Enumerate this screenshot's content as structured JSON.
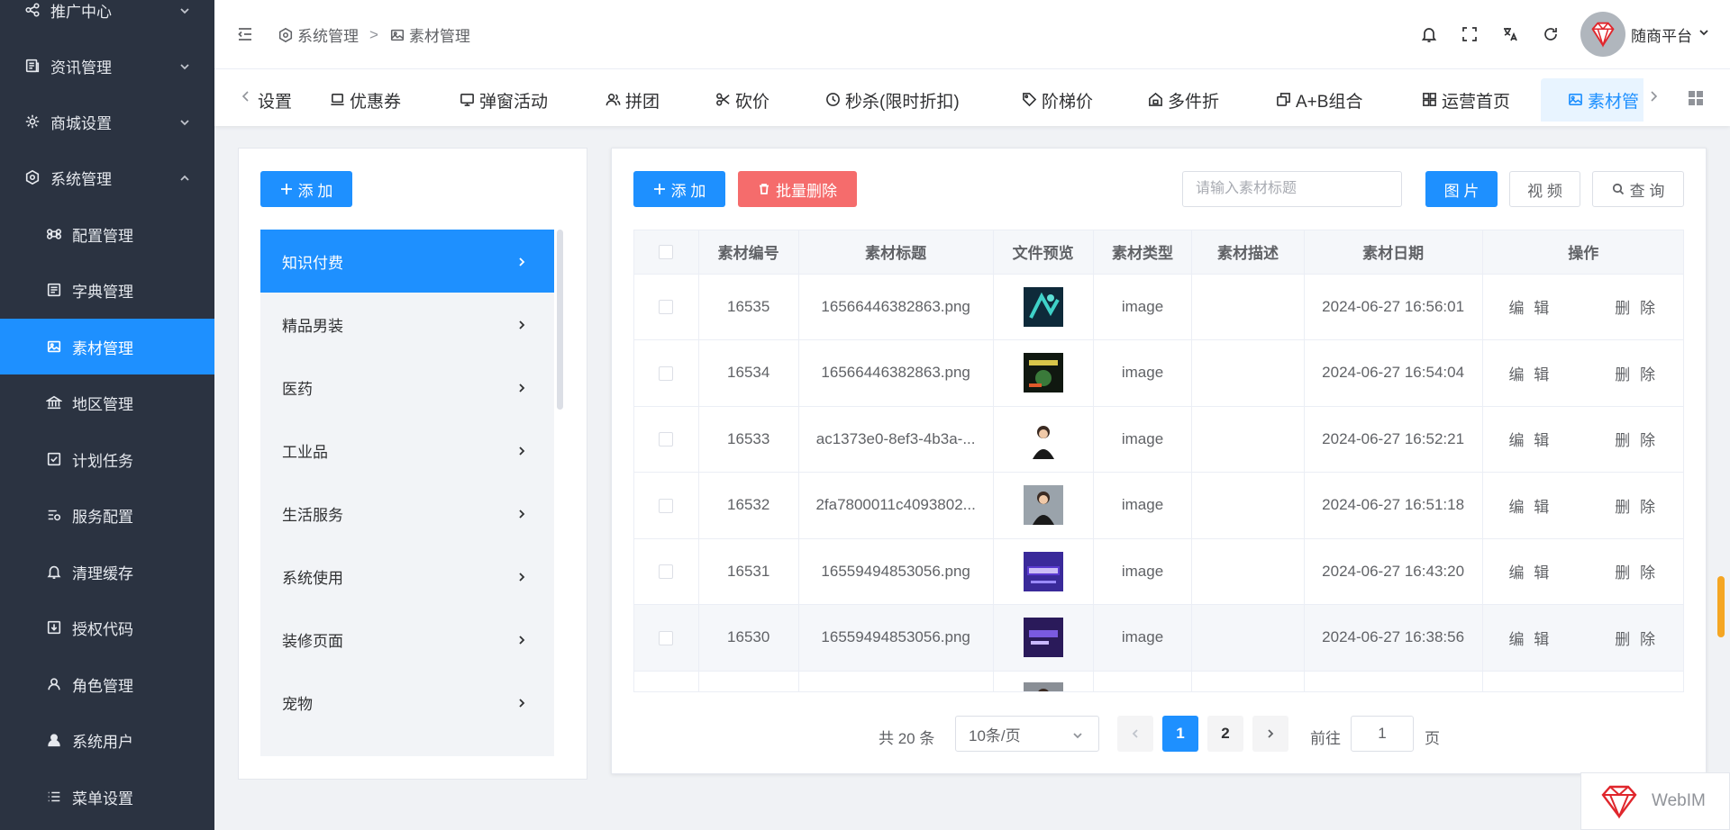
{
  "sidebar": {
    "items": [
      {
        "label": "推广中心",
        "icon": "share-icon",
        "expandable": true
      },
      {
        "label": "资讯管理",
        "icon": "document-icon",
        "expandable": true
      },
      {
        "label": "商城设置",
        "icon": "gear-icon",
        "expandable": true
      },
      {
        "label": "系统管理",
        "icon": "hexagon-gear-icon",
        "expandable": true,
        "expanded": true
      }
    ],
    "sub_items": [
      {
        "label": "配置管理",
        "icon": "command-icon"
      },
      {
        "label": "字典管理",
        "icon": "list-doc-icon"
      },
      {
        "label": "素材管理",
        "icon": "image-edit-icon",
        "active": true
      },
      {
        "label": "地区管理",
        "icon": "bank-icon"
      },
      {
        "label": "计划任务",
        "icon": "check-square-icon"
      },
      {
        "label": "服务配置",
        "icon": "service-icon"
      },
      {
        "label": "清理缓存",
        "icon": "bell-clean-icon"
      },
      {
        "label": "授权代码",
        "icon": "download-box-icon"
      },
      {
        "label": "角色管理",
        "icon": "user-icon"
      },
      {
        "label": "系统用户",
        "icon": "user-solid-icon"
      },
      {
        "label": "菜单设置",
        "icon": "menu-list-icon"
      }
    ]
  },
  "header": {
    "breadcrumb": [
      {
        "label": "系统管理",
        "icon": "hexagon-gear-icon"
      },
      {
        "label": "素材管理",
        "icon": "image-edit-icon"
      }
    ],
    "separator": ">",
    "tools": [
      "bell-icon",
      "fullscreen-icon",
      "translate-icon",
      "refresh-icon"
    ],
    "user_name": "随商平台"
  },
  "tabs": [
    {
      "label": "设置",
      "icon": ""
    },
    {
      "label": "优惠券",
      "icon": "laptop-icon"
    },
    {
      "label": "弹窗活动",
      "icon": "monitor-icon"
    },
    {
      "label": "拼团",
      "icon": "users-icon"
    },
    {
      "label": "砍价",
      "icon": "scissors-icon"
    },
    {
      "label": "秒杀(限时折扣)",
      "icon": "clock-icon"
    },
    {
      "label": "阶梯价",
      "icon": "tag-icon"
    },
    {
      "label": "多件折",
      "icon": "house-icon"
    },
    {
      "label": "A+B组合",
      "icon": "copy-icon"
    },
    {
      "label": "运营首页",
      "icon": "grid-icon"
    },
    {
      "label": "素材管",
      "icon": "image-edit-icon",
      "active": true
    }
  ],
  "categories": {
    "add_label": "添 加",
    "items": [
      {
        "label": "知识付费",
        "active": true
      },
      {
        "label": "精品男装"
      },
      {
        "label": "医药"
      },
      {
        "label": "工业品"
      },
      {
        "label": "生活服务"
      },
      {
        "label": "系统使用"
      },
      {
        "label": "装修页面"
      },
      {
        "label": "宠物"
      }
    ]
  },
  "toolbar": {
    "add_label": "添 加",
    "batch_delete_label": "批量删除",
    "search_placeholder": "请输入素材标题",
    "search_value": "",
    "filter_image": "图 片",
    "filter_video": "视 频",
    "query_label": "查 询"
  },
  "table": {
    "columns": [
      "素材编号",
      "素材标题",
      "文件预览",
      "素材类型",
      "素材描述",
      "素材日期",
      "操作"
    ],
    "rows": [
      {
        "id": "16535",
        "title": "16566446382863.png",
        "type": "image",
        "desc": "",
        "date": "2024-06-27 16:56:01",
        "thumb": "teal"
      },
      {
        "id": "16534",
        "title": "16566446382863.png",
        "type": "image",
        "desc": "",
        "date": "2024-06-27 16:54:04",
        "thumb": "dark"
      },
      {
        "id": "16533",
        "title": "ac1373e0-8ef3-4b3a-...",
        "type": "image",
        "desc": "",
        "date": "2024-06-27 16:52:21",
        "thumb": "person"
      },
      {
        "id": "16532",
        "title": "2fa7800011c4093802...",
        "type": "image",
        "desc": "",
        "date": "2024-06-27 16:51:18",
        "thumb": "person2"
      },
      {
        "id": "16531",
        "title": "16559494853056.png",
        "type": "image",
        "desc": "",
        "date": "2024-06-27 16:43:20",
        "thumb": "java"
      },
      {
        "id": "16530",
        "title": "16559494853056.png",
        "type": "image",
        "desc": "",
        "date": "2024-06-27 16:38:56",
        "thumb": "purple"
      },
      {
        "id": "",
        "title": "",
        "type": "",
        "desc": "",
        "date": "",
        "thumb": "partial"
      }
    ],
    "edit_label": "编 辑",
    "delete_label": "删 除"
  },
  "pagination": {
    "total": "共 20 条",
    "page_size": "10条/页",
    "pages": [
      "1",
      "2"
    ],
    "current": "1",
    "goto_label": "前往",
    "goto_value": "1",
    "unit": "页"
  },
  "webim": {
    "label": "WebIM"
  },
  "colors": {
    "primary": "#1e90ff",
    "danger": "#f56c6c",
    "sidebar": "#2b3341"
  }
}
